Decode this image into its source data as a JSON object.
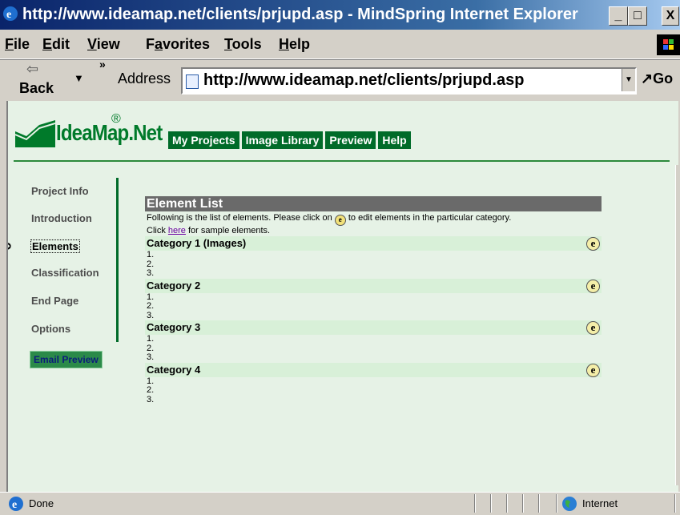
{
  "window": {
    "title": "http://www.ideamap.net/clients/prjupd.asp - MindSpring Internet Explorer",
    "icon": "ie-icon",
    "controls": [
      "_",
      "□",
      "X"
    ]
  },
  "menu": [
    "File",
    "Edit",
    "View",
    "Favorites",
    "Tools",
    "Help"
  ],
  "toolbar": {
    "back_label": "Back",
    "address_label": "Address",
    "address_value": "http://www.ideamap.net/clients/prjupd.asp",
    "go_label": "Go",
    "chevron": "»"
  },
  "page": {
    "logo_text": "IdeaMap.Net",
    "logo_reg": "®",
    "top_nav": [
      "My Projects",
      "Image Library",
      "Preview",
      "Help"
    ],
    "left_nav": [
      "Project Info",
      "Introduction",
      "Elements",
      "Classification",
      "End Page",
      "Options"
    ],
    "active_left_nav": "Elements",
    "email_preview": "Email Preview",
    "element_list": {
      "title": "Element List",
      "desc_part1": "Following is the list of elements. Please click on",
      "desc_part2": "to edit elements in the particular category.",
      "click": "Click",
      "here_link": "here",
      "desc_part3": "for sample elements.",
      "edit_icon_glyph": "e",
      "categories": [
        {
          "name": "Category 1 (Images)",
          "items": [
            "1.",
            "2.",
            "3."
          ]
        },
        {
          "name": "Category 2",
          "items": [
            "1.",
            "2.",
            "3."
          ]
        },
        {
          "name": "Category 3",
          "items": [
            "1.",
            "2.",
            "3."
          ]
        },
        {
          "name": "Category 4",
          "items": [
            "1.",
            "2.",
            "3."
          ]
        }
      ]
    }
  },
  "status": {
    "text": "Done",
    "zone": "Internet"
  },
  "colors": {
    "brand_green": "#006b29",
    "page_bg": "#e6f2e6",
    "header_gray": "#6a6a6a"
  }
}
